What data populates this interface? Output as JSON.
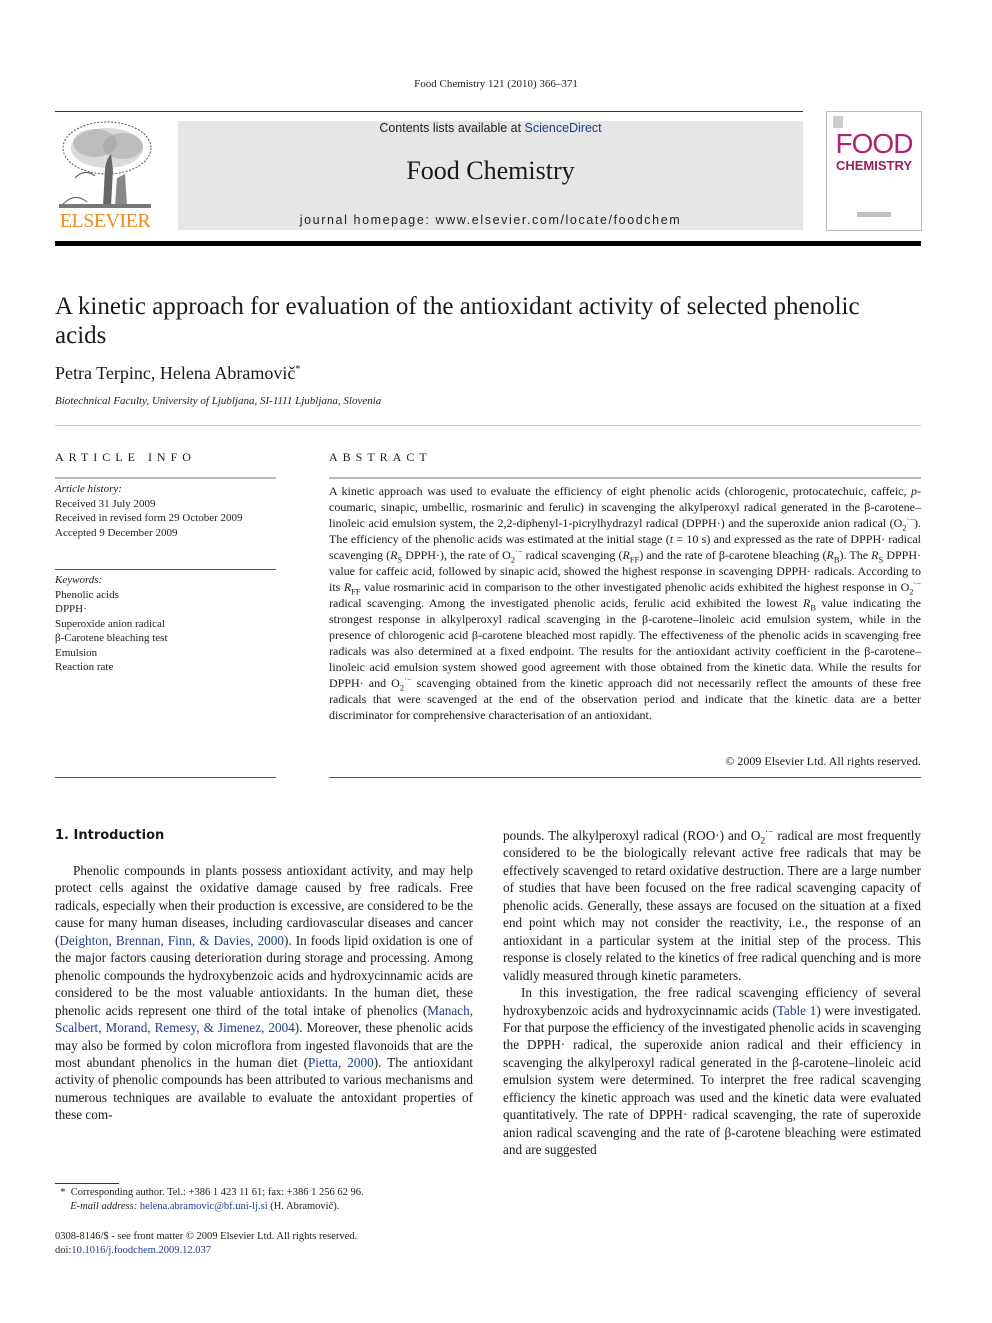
{
  "running_head": "Food Chemistry 121 (2010) 366–371",
  "publisher": {
    "name": "ELSEVIER",
    "color": "#f08a1e"
  },
  "masthead": {
    "contents_prefix": "Contents lists available at ",
    "contents_link": "ScienceDirect",
    "journal_title": "Food Chemistry",
    "homepage": "journal homepage: www.elsevier.com/locate/foodchem"
  },
  "cover": {
    "line1": "FOOD",
    "line2": "CHEMISTRY",
    "color": "#b0246e"
  },
  "article": {
    "title": "A kinetic approach for evaluation of the antioxidant activity of selected phenolic acids",
    "authors": "Petra Terpinc, Helena Abramovič",
    "author_mark": "*",
    "affiliation": "Biotechnical Faculty, University of Ljubljana, SI-1111 Ljubljana, Slovenia"
  },
  "article_info": {
    "heading": "ARTICLE INFO",
    "history_label": "Article history:",
    "history": [
      "Received 31 July 2009",
      "Received in revised form 29 October 2009",
      "Accepted 9 December 2009"
    ],
    "keywords_label": "Keywords:",
    "keywords": [
      "Phenolic acids",
      "DPPH·",
      "Superoxide anion radical",
      "β-Carotene bleaching test",
      "Emulsion",
      "Reaction rate"
    ]
  },
  "abstract": {
    "heading": "ABSTRACT",
    "p1": "A kinetic approach was used to evaluate the efficiency of eight phenolic acids (chlorogenic, protocatechuic, caffeic, ",
    "p_italic": "p",
    "p2": "-coumaric, sinapic, umbellic, rosmarinic and ferulic) in scavenging the alkylperoxyl radical generated in the β-carotene–linoleic acid emulsion system, the 2,2-diphenyl-1-picrylhydrazyl radical (DPPH·) and the superoxide anion radical (O",
    "p3": "). The efficiency of the phenolic acids was estimated at the initial stage (",
    "t_var": "t",
    "p4": " = 10 s) and expressed as the rate of DPPH· radical scavenging (",
    "p5": " DPPH·), the rate of O",
    "p6": " radical scavenging (",
    "p7": ") and the rate of β-carotene bleaching (",
    "p8": "). The ",
    "p9": " DPPH· value for caffeic acid, followed by sinapic acid, showed the highest response in scavenging DPPH· radicals. According to its ",
    "p10": " value rosmarinic acid in comparison to the other investigated phenolic acids exhibited the highest response in O",
    "p11": " radical scavenging. Among the investigated phenolic acids, ferulic acid exhibited the lowest ",
    "p12": " value indicating the strongest response in alkylperoxyl radical scavenging in the β-carotene–linoleic acid emulsion system, while in the presence of chlorogenic acid β-carotene bleached most rapidly. The effectiveness of the phenolic acids in scavenging free radicals was also determined at a fixed endpoint. The results for the antioxidant activity coefficient in the β-carotene–linoleic acid emulsion system showed good agreement with those obtained from the kinetic data. While the results for DPPH· and O",
    "p13": " scavenging obtained from the kinetic approach did not necessarily reflect the amounts of these free radicals that were scavenged at the end of the observation period and indicate that the kinetic data are a better discriminator for comprehensive characterisation of an antioxidant.",
    "r": "R",
    "sub_s": "S",
    "sub_ff": "FF",
    "sub_b": "B",
    "o2_sub": "2",
    "o2_sup": "·−",
    "copyright": "© 2009 Elsevier Ltd. All rights reserved."
  },
  "intro": {
    "heading": "1. Introduction",
    "left_a": "Phenolic compounds in plants possess antioxidant activity, and may help protect cells against the oxidative damage caused by free radicals. Free radicals, especially when their production is excessive, are considered to be the cause for many human diseases, including cardiovascular diseases and cancer (",
    "ref1": "Deighton, Brennan, Finn, & Davies, 2000",
    "left_b": "). In foods lipid oxidation is one of the major factors causing deterioration during storage and processing. Among phenolic compounds the hydroxybenzoic acids and hydroxycinnamic acids are considered to be the most valuable antioxidants. In the human diet, these phenolic acids represent one third of the total intake of phenolics (",
    "ref2": "Manach, Scalbert, Morand, Remesy, & Jimenez, 2004",
    "left_c": "). Moreover, these phenolic acids may also be formed by colon microflora from ingested flavonoids that are the most abundant phenolics in the human diet (",
    "ref3": "Pietta, 2000",
    "left_d": "). The antioxidant activity of phenolic compounds has been attributed to various mechanisms and numerous techniques are available to evaluate the antoxidant properties of these com-",
    "right_a": "pounds. The alkylperoxyl radical (ROO·) and O",
    "right_b": " radical are most frequently considered to be the biologically relevant active free radicals that may be effectively scavenged to retard oxidative destruction. There are a large number of studies that have been focused on the free radical scavenging capacity of phenolic acids. Generally, these assays are focused on the situation at a fixed end point which may not consider the reactivity, i.e., the response of an antioxidant in a particular system at the initial step of the process. This response is closely related to the kinetics of free radical quenching and is more validly measured through kinetic parameters.",
    "right_c": "In this investigation, the free radical scavenging efficiency of several hydroxybenzoic acids and hydroxycinnamic acids (",
    "ref4": "Table 1",
    "right_d": ") were investigated. For that purpose the efficiency of the investigated phenolic acids in scavenging the DPPH· radical, the superoxide anion radical and their efficiency in scavenging the alkylperoxyl radical generated in the β-carotene–linoleic acid emulsion system were determined. To interpret the free radical scavenging efficiency the kinetic approach was used and the kinetic data were evaluated quantitatively. The rate of DPPH· radical scavenging, the rate of superoxide anion radical scavenging and the rate of β-carotene bleaching were estimated and are suggested"
  },
  "footnote": {
    "mark": "*",
    "line1": "Corresponding author. Tel.: +386 1 423 11 61; fax: +386 1 256 62 96.",
    "email_label": "E-mail address:",
    "email": "helena.abramovic@bf.uni-lj.si",
    "email_suffix": " (H. Abramovič)."
  },
  "front_matter": {
    "issn": "0308-8146/$ - see front matter © 2009 Elsevier Ltd. All rights reserved.",
    "doi_prefix": "doi:",
    "doi": "10.1016/j.foodchem.2009.12.037"
  },
  "colors": {
    "link": "#1f3d8f",
    "masthead_bg": "#e6e6e6"
  }
}
